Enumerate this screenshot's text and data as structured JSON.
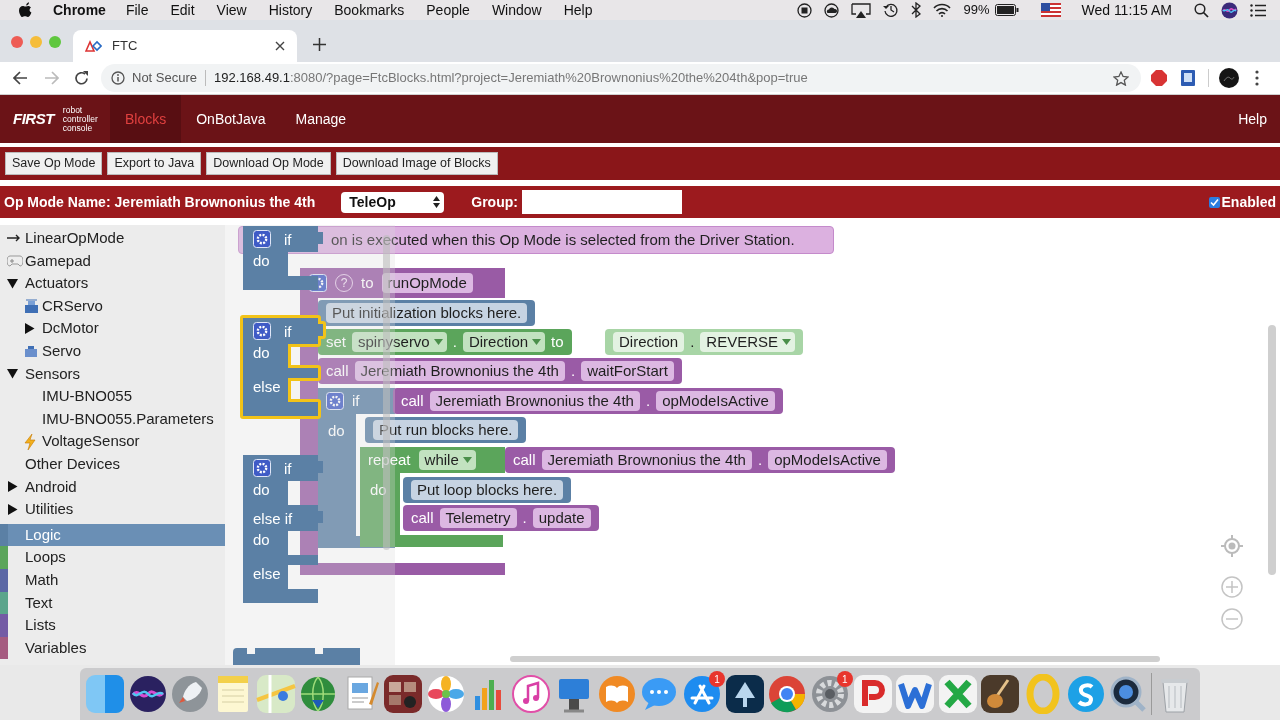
{
  "menu_bar": {
    "app": "Chrome",
    "menus": [
      "File",
      "Edit",
      "View",
      "History",
      "Bookmarks",
      "People",
      "Window",
      "Help"
    ],
    "battery": "99%",
    "clock": "Wed 11:15 AM"
  },
  "browser": {
    "tab": {
      "title": "FTC"
    },
    "address": {
      "security": "Not Secure",
      "host": "192.168.49.1",
      "path": ":8080/?page=FtcBlocks.html?project=Jeremiath%20Brownonius%20the%204th&pop=true"
    }
  },
  "app_header": {
    "logo": "FIRST",
    "logo_caption": [
      "robot",
      "controller",
      "console"
    ],
    "tabs": [
      {
        "label": "Blocks",
        "selected": true
      },
      {
        "label": "OnBotJava",
        "selected": false
      },
      {
        "label": "Manage",
        "selected": false
      }
    ],
    "help": "Help"
  },
  "toolbar": {
    "buttons": [
      "Save Op Mode",
      "Export to Java",
      "Download Op Mode",
      "Download Image of Blocks"
    ]
  },
  "op_mode": {
    "name_label": "Op Mode Name:",
    "name": "Jeremiath Brownonius the 4th",
    "type": "TeleOp",
    "group_label": "Group:",
    "enabled": {
      "label": "Enabled",
      "checked": true
    }
  },
  "toolbox": {
    "tree": [
      {
        "label": "LinearOpMode",
        "kind": "arrow"
      },
      {
        "label": "Gamepad",
        "kind": "gamepad"
      },
      {
        "label": "Actuators",
        "expanded": true,
        "children": [
          {
            "label": "CRServo",
            "kind": "crservo"
          },
          {
            "label": "DcMotor",
            "expanded": false
          },
          {
            "label": "Servo",
            "kind": "servo"
          }
        ]
      },
      {
        "label": "Sensors",
        "expanded": true,
        "children": [
          {
            "label": "IMU-BNO055"
          },
          {
            "label": "IMU-BNO055.Parameters"
          },
          {
            "label": "VoltageSensor",
            "kind": "bolt"
          }
        ]
      },
      {
        "label": "Other Devices"
      },
      {
        "label": "Android",
        "expanded": false
      },
      {
        "label": "Utilities",
        "expanded": false
      }
    ],
    "categories": [
      {
        "label": "Logic",
        "color": "#5b80a5",
        "selected": true
      },
      {
        "label": "Loops",
        "color": "#5ba55b",
        "selected": false
      },
      {
        "label": "Math",
        "color": "#5b67a5",
        "selected": false
      },
      {
        "label": "Text",
        "color": "#5ba58c",
        "selected": false
      },
      {
        "label": "Lists",
        "color": "#745ba5",
        "selected": false
      },
      {
        "label": "Variables",
        "color": "#a55b80",
        "selected": false
      }
    ]
  },
  "workspace": {
    "comment": "on is executed when this Op Mode is selected from the Driver Station.",
    "function": {
      "help": "?",
      "keyword": "to",
      "name": "runOpMode"
    },
    "init_comment": "Put initialization blocks here.",
    "set_block": {
      "keyword": "set",
      "device": "spinyservo",
      "separator": ".",
      "property": "Direction",
      "to": "to",
      "value_type": "Direction",
      "value_separator": ".",
      "value": "REVERSE"
    },
    "wait_call": {
      "keyword": "call",
      "target": "Jeremiath Brownonius the 4th",
      "separator": ".",
      "method": "waitForStart"
    },
    "if_block": {
      "if": "if",
      "do": "do",
      "condition": {
        "keyword": "call",
        "target": "Jeremiath Brownonius the 4th",
        "separator": ".",
        "method": "opModeIsActive"
      }
    },
    "run_comment": "Put run blocks here.",
    "repeat_block": {
      "keyword": "repeat",
      "mode": "while",
      "do": "do",
      "condition": {
        "keyword": "call",
        "target": "Jeremiath Brownonius the 4th",
        "separator": ".",
        "method": "opModeIsActive"
      }
    },
    "loop_comment": "Put loop blocks here.",
    "telemetry_call": {
      "keyword": "call",
      "target": "Telemetry",
      "separator": ".",
      "method": "update"
    }
  },
  "flyout": {
    "blocks": [
      {
        "kind": "if_do",
        "highlighted": false,
        "labels": [
          "if",
          "do"
        ]
      },
      {
        "kind": "if_else",
        "highlighted": true,
        "labels": [
          "if",
          "do",
          "else"
        ]
      },
      {
        "kind": "if_elseif_else",
        "highlighted": false,
        "labels": [
          "if",
          "do",
          "else if",
          "do",
          "else"
        ]
      },
      {
        "kind": "compare",
        "highlighted": false
      }
    ]
  },
  "dock": {
    "apps": [
      {
        "kind": "finder"
      },
      {
        "kind": "orb"
      },
      {
        "kind": "rocket"
      },
      {
        "kind": "notes"
      },
      {
        "kind": "maps"
      },
      {
        "kind": "globe"
      },
      {
        "kind": "document"
      },
      {
        "kind": "photostrip"
      },
      {
        "kind": "flower"
      },
      {
        "kind": "chart"
      },
      {
        "kind": "music"
      },
      {
        "kind": "podium"
      },
      {
        "kind": "book"
      },
      {
        "kind": "messages"
      },
      {
        "kind": "store",
        "badge": "1"
      },
      {
        "kind": "reader"
      },
      {
        "kind": "ring"
      },
      {
        "kind": "gear",
        "badge": "1"
      },
      {
        "kind": "red_app"
      },
      {
        "kind": "blue_app"
      },
      {
        "kind": "green_app"
      },
      {
        "kind": "guitar"
      },
      {
        "kind": "yellow_ring"
      },
      {
        "kind": "cloud_app"
      },
      {
        "kind": "lens"
      },
      {
        "kind": "trash"
      }
    ]
  }
}
